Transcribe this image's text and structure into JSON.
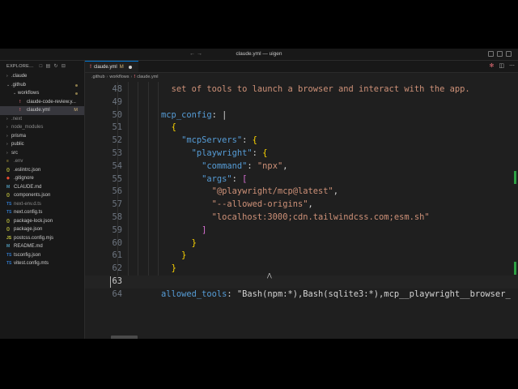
{
  "window": {
    "title": "claude.yml — uigen"
  },
  "sidebar": {
    "header": "EXPLORE...",
    "items": [
      {
        "label": ".claude",
        "kind": "folder",
        "dim": false
      },
      {
        "label": ".github",
        "kind": "folder-open",
        "dim": false,
        "dot": true
      },
      {
        "label": "workflows",
        "kind": "folder-open",
        "dim": false,
        "dot": true
      },
      {
        "label": "claude-code-review.y...",
        "kind": "yml",
        "dim": false
      },
      {
        "label": "claude.yml",
        "kind": "yml",
        "dim": false,
        "badge": "M",
        "active": true
      },
      {
        "label": ".next",
        "kind": "folder",
        "dim": true
      },
      {
        "label": "node_modules",
        "kind": "folder",
        "dim": true
      },
      {
        "label": "prisma",
        "kind": "folder",
        "dim": false
      },
      {
        "label": "public",
        "kind": "folder",
        "dim": false
      },
      {
        "label": "src",
        "kind": "folder",
        "dim": false
      },
      {
        "label": ".env",
        "kind": "file",
        "dim": true
      },
      {
        "label": ".eslintrc.json",
        "kind": "json",
        "dim": false
      },
      {
        "label": ".gitignore",
        "kind": "git",
        "dim": false
      },
      {
        "label": "CLAUDE.md",
        "kind": "md",
        "dim": false
      },
      {
        "label": "components.json",
        "kind": "json",
        "dim": false
      },
      {
        "label": "next-env.d.ts",
        "kind": "ts",
        "dim": true
      },
      {
        "label": "next.config.ts",
        "kind": "ts",
        "dim": false
      },
      {
        "label": "package-lock.json",
        "kind": "json",
        "dim": false
      },
      {
        "label": "package.json",
        "kind": "json",
        "dim": false
      },
      {
        "label": "postcss.config.mjs",
        "kind": "js",
        "dim": false
      },
      {
        "label": "README.md",
        "kind": "md",
        "dim": false
      },
      {
        "label": "tsconfig.json",
        "kind": "ts",
        "dim": false
      },
      {
        "label": "vitest.config.mts",
        "kind": "ts",
        "dim": false
      }
    ]
  },
  "tab": {
    "label": "claude.yml",
    "status": "M"
  },
  "breadcrumb": [
    ".github",
    "workflows",
    "claude.yml"
  ],
  "editor": {
    "lines": [
      {
        "num": "48",
        "text": "          set of tools to launch a browser and interact with the app."
      },
      {
        "num": "49",
        "text": ""
      },
      {
        "num": "50",
        "text": "        mcp_config: |"
      },
      {
        "num": "51",
        "text": "          {"
      },
      {
        "num": "52",
        "text": "            \"mcpServers\": {"
      },
      {
        "num": "53",
        "text": "              \"playwright\": {"
      },
      {
        "num": "54",
        "text": "                \"command\": \"npx\","
      },
      {
        "num": "55",
        "text": "                \"args\": ["
      },
      {
        "num": "56",
        "text": "                  \"@playwright/mcp@latest\","
      },
      {
        "num": "57",
        "text": "                  \"--allowed-origins\","
      },
      {
        "num": "58",
        "text": "                  \"localhost:3000;cdn.tailwindcss.com;esm.sh\""
      },
      {
        "num": "59",
        "text": "                ]"
      },
      {
        "num": "60",
        "text": "              }"
      },
      {
        "num": "61",
        "text": "            }"
      },
      {
        "num": "62",
        "text": "          }"
      },
      {
        "num": "63",
        "text": ""
      },
      {
        "num": "64",
        "text": "        allowed_tools: \"Bash(npm:*),Bash(sqlite3:*),mcp__playwright__browser_"
      }
    ],
    "current_line": "63"
  },
  "colors": {
    "key": "#569cd6",
    "string": "#ce9178",
    "accent": "#0078d4",
    "modified": "#d7ba7d"
  }
}
